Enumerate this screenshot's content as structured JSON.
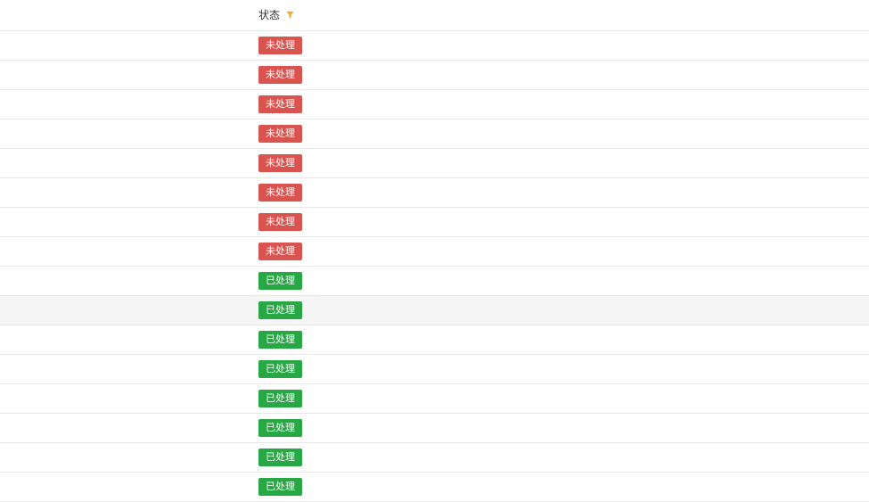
{
  "column": {
    "header": "状态"
  },
  "status_labels": {
    "unprocessed": "未处理",
    "processed": "已处理"
  },
  "colors": {
    "unprocessed": "#d9534f",
    "processed": "#28a745",
    "filter_active": "#f5a623"
  },
  "rows": [
    {
      "status": "unprocessed",
      "hovered": false
    },
    {
      "status": "unprocessed",
      "hovered": false
    },
    {
      "status": "unprocessed",
      "hovered": false
    },
    {
      "status": "unprocessed",
      "hovered": false
    },
    {
      "status": "unprocessed",
      "hovered": false
    },
    {
      "status": "unprocessed",
      "hovered": false
    },
    {
      "status": "unprocessed",
      "hovered": false
    },
    {
      "status": "unprocessed",
      "hovered": false
    },
    {
      "status": "processed",
      "hovered": false
    },
    {
      "status": "processed",
      "hovered": true
    },
    {
      "status": "processed",
      "hovered": false
    },
    {
      "status": "processed",
      "hovered": false
    },
    {
      "status": "processed",
      "hovered": false
    },
    {
      "status": "processed",
      "hovered": false
    },
    {
      "status": "processed",
      "hovered": false
    },
    {
      "status": "processed",
      "hovered": false
    }
  ]
}
